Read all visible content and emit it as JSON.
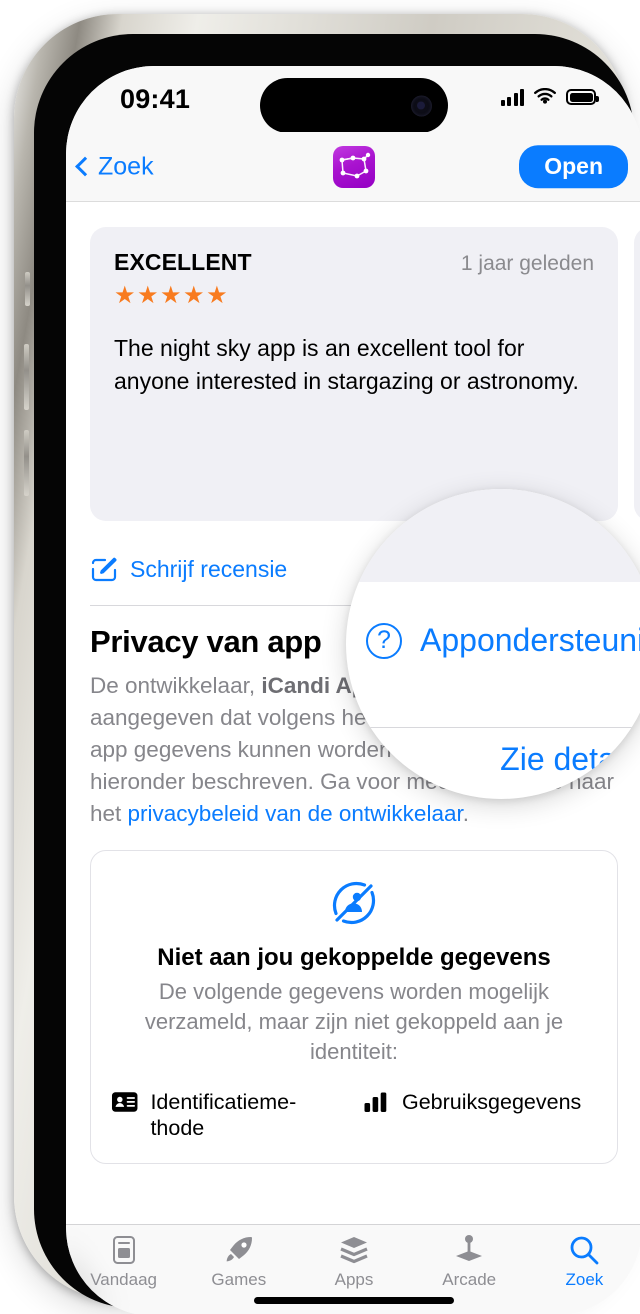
{
  "status_bar": {
    "time": "09:41",
    "cellular_icon": "cellular-bars-icon",
    "wifi_icon": "wifi-icon",
    "battery_icon": "battery-full-icon"
  },
  "nav_bar": {
    "back_label": "Zoek",
    "app_icon": "constellation-app-icon",
    "open_label": "Open"
  },
  "review": {
    "title": "EXCELLENT",
    "date": "1 jaar geleden",
    "stars": "★★★★★",
    "star_color": "#F87B1F",
    "body": "The night sky app is an excellent tool for anyone interested in stargazing or astronomy."
  },
  "actions": {
    "write_review_label": "Schrijf recensie",
    "write_review_icon": "pencil-square-icon",
    "app_support_label": "Appondersteuning",
    "app_support_icon": "question-circle-icon"
  },
  "privacy": {
    "title": "Privacy van app",
    "see_details_label": "Zie details",
    "desc_part1": "De ontwikkelaar, ",
    "desc_developer": "iCandi Apps Ltd",
    "desc_part2": " heeft aangegeven dat volgens het privacybeleid van de app gegevens kunnen worden beheerd zoals hieronder beschreven. Ga voor meer informatie naar het ",
    "desc_link": "privacybeleid van de ontwikkelaar",
    "desc_part3": "."
  },
  "data_card": {
    "icon": "privacy-hand-slash-icon",
    "title": "Niet aan jou gekoppelde gegevens",
    "subtitle": "De volgende gegevens worden mogelijk verzameld, maar zijn niet gekoppeld aan je identiteit:",
    "items": [
      {
        "icon": "identification-card-icon",
        "label": "Identificatieme-thode"
      },
      {
        "icon": "bar-chart-icon",
        "label": "Gebruiksgegevens"
      }
    ]
  },
  "tab_bar": {
    "tabs": [
      {
        "icon": "document-icon",
        "label": "Vandaag",
        "active": false
      },
      {
        "icon": "rocket-icon",
        "label": "Games",
        "active": false
      },
      {
        "icon": "stack-icon",
        "label": "Apps",
        "active": false
      },
      {
        "icon": "joystick-icon",
        "label": "Arcade",
        "active": false
      },
      {
        "icon": "search-icon",
        "label": "Zoek",
        "active": true
      }
    ]
  },
  "magnifier": {
    "app_support_label": "Appondersteuning",
    "see_details_label": "Zie details",
    "support_icon": "question-circle-icon"
  },
  "colors": {
    "accent": "#0A7CFF",
    "star": "#F87B1F",
    "card_grey": "#F0F0F5",
    "muted_text": "#86868B"
  }
}
